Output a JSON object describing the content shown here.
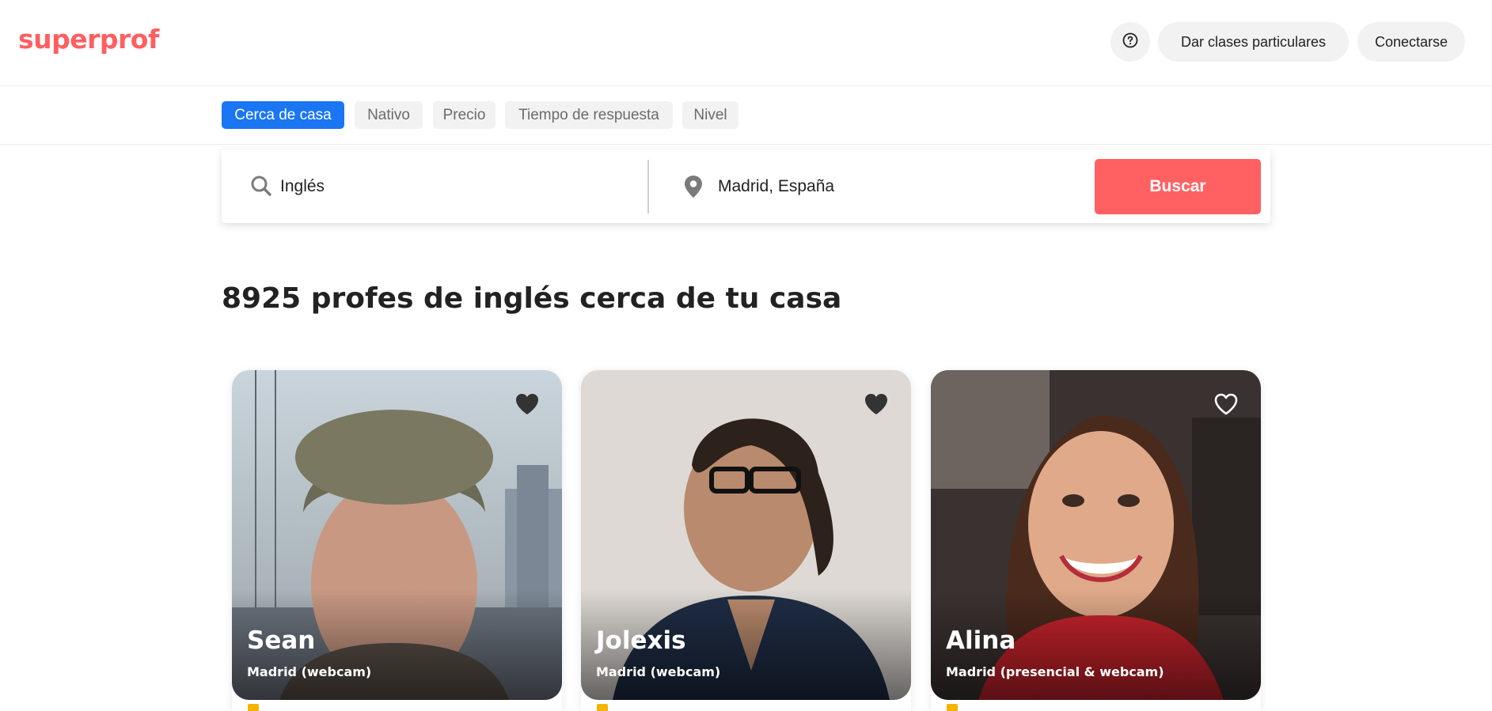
{
  "header": {
    "logo": "superprof",
    "help_icon": "question-circle-icon",
    "teach_label": "Dar clases particulares",
    "login_label": "Conectarse"
  },
  "filters": [
    {
      "label": "Cerca de casa",
      "active": true
    },
    {
      "label": "Nativo",
      "active": false
    },
    {
      "label": "Precio",
      "active": false
    },
    {
      "label": "Tiempo de respuesta",
      "active": false
    },
    {
      "label": "Nivel",
      "active": false
    }
  ],
  "search": {
    "subject_value": "Inglés",
    "location_value": "Madrid, España",
    "button_label": "Buscar",
    "search_icon": "search-icon",
    "location_icon": "map-pin-icon"
  },
  "results": {
    "title": "8925 profes de inglés cerca de tu casa"
  },
  "tutors": [
    {
      "name": "Sean",
      "location": "Madrid (webcam)",
      "favorite": true
    },
    {
      "name": "Jolexis",
      "location": "Madrid (webcam)",
      "favorite": true
    },
    {
      "name": "Alina",
      "location": "Madrid (presencial & webcam)",
      "favorite": false
    }
  ],
  "colors": {
    "brand": "#ff5f61",
    "accent_blue": "#1a76f2",
    "search_button": "#ff6163",
    "chip_bg": "#f2f2f2"
  }
}
